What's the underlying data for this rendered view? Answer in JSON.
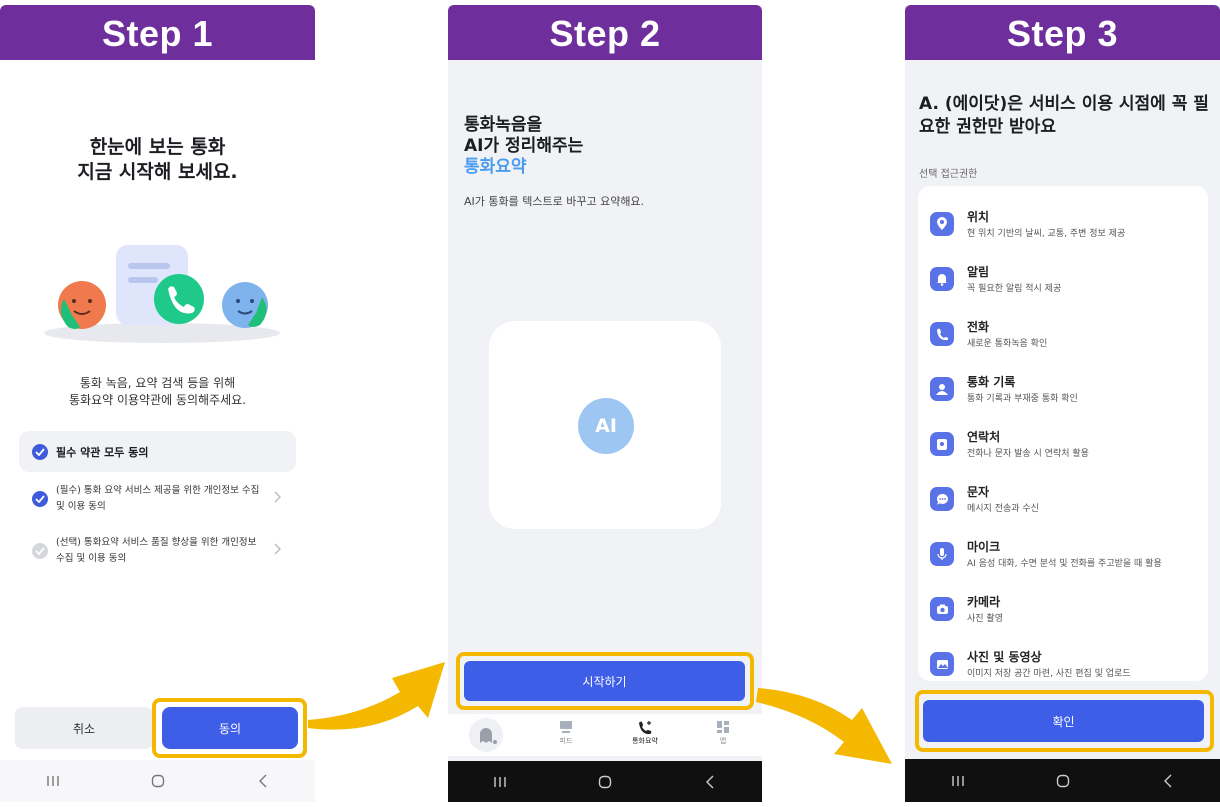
{
  "steps": {
    "step1": "Step 1",
    "step2": "Step 2",
    "step3": "Step 3"
  },
  "screen1": {
    "title_line1": "한눈에 보는 통화",
    "title_line2": "지금 시작해 보세요.",
    "desc_line1": "통화 녹음, 요약 검색 등을 위해",
    "desc_line2": "통화요약 이용약관에 동의해주세요.",
    "agree_all": "필수 약관 모두 동의",
    "terms": [
      {
        "text": "(필수) 통화 요약 서비스 제공을 위한 개인정보 수집 및 이용 동의",
        "checked": true
      },
      {
        "text": "(선택) 통화요약 서비스 품질 향상을 위한 개인정보 수집 및 이용 동의",
        "checked": false
      }
    ],
    "cancel_label": "취소",
    "agree_label": "동의"
  },
  "screen2": {
    "title_line1": "통화녹음을",
    "title_line2": "AI가 정리해주는",
    "title_accent": "통화요약",
    "subtitle": "AI가 통화를 텍스트로 바꾸고 요약해요.",
    "ai_badge": "AI",
    "start_label": "시작하기",
    "tabs": [
      "",
      "피드",
      "통화요약",
      "앱"
    ]
  },
  "screen3": {
    "title": "A. (에이닷)은 서비스 이용 시점에 꼭 필요한 권한만 받아요",
    "section_label": "선택 접근권한",
    "permissions": [
      {
        "name": "위치",
        "desc": "현 위치 기반의 날씨, 교통, 주변 정보 제공",
        "icon": "location-icon"
      },
      {
        "name": "알림",
        "desc": "꼭 필요한 알림 적시 제공",
        "icon": "bell-icon"
      },
      {
        "name": "전화",
        "desc": "새로운 통화녹음 확인",
        "icon": "phone-icon"
      },
      {
        "name": "통화 기록",
        "desc": "통화 기록과 부재중 통화 확인",
        "icon": "person-icon"
      },
      {
        "name": "연락처",
        "desc": "전화나 문자 발송 시 연락처 활용",
        "icon": "contacts-icon"
      },
      {
        "name": "문자",
        "desc": "메시지 전송과 수신",
        "icon": "message-icon"
      },
      {
        "name": "마이크",
        "desc": "AI 음성 대화, 수면 분석 및 전화를 주고받을 때 활용",
        "icon": "mic-icon"
      },
      {
        "name": "카메라",
        "desc": "사진 촬영",
        "icon": "camera-icon"
      },
      {
        "name": "사진 및 동영상",
        "desc": "이미지 저장 공간 마련, 사진 편집 및 업로드",
        "icon": "photo-icon"
      }
    ],
    "ok_label": "확인"
  },
  "colors": {
    "header": "#6e2f9c",
    "primary_button": "#3f5ee8",
    "highlight": "#f5b800",
    "accent_text": "#4a9cf0"
  }
}
